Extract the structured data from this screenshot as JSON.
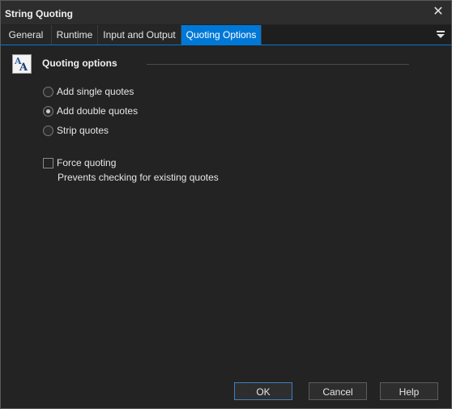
{
  "window": {
    "title": "String Quoting",
    "close_glyph": "✕"
  },
  "tabs": [
    {
      "label": "General"
    },
    {
      "label": "Runtime"
    },
    {
      "label": "Input and Output"
    },
    {
      "label": "Quoting Options"
    }
  ],
  "active_tab": "Quoting Options",
  "section": {
    "title": "Quoting options",
    "icon": "text-font-icon",
    "icon_letters": "AA"
  },
  "radio_options": [
    {
      "label": "Add single quotes",
      "checked": false
    },
    {
      "label": "Add double quotes",
      "checked": true
    },
    {
      "label": "Strip quotes",
      "checked": false
    }
  ],
  "force_quoting": {
    "label": "Force quoting",
    "checked": false,
    "hint": "Prevents checking for existing quotes"
  },
  "buttons": {
    "ok": "OK",
    "cancel": "Cancel",
    "help": "Help"
  },
  "colors": {
    "background": "#232323",
    "accent": "#0078d7"
  }
}
